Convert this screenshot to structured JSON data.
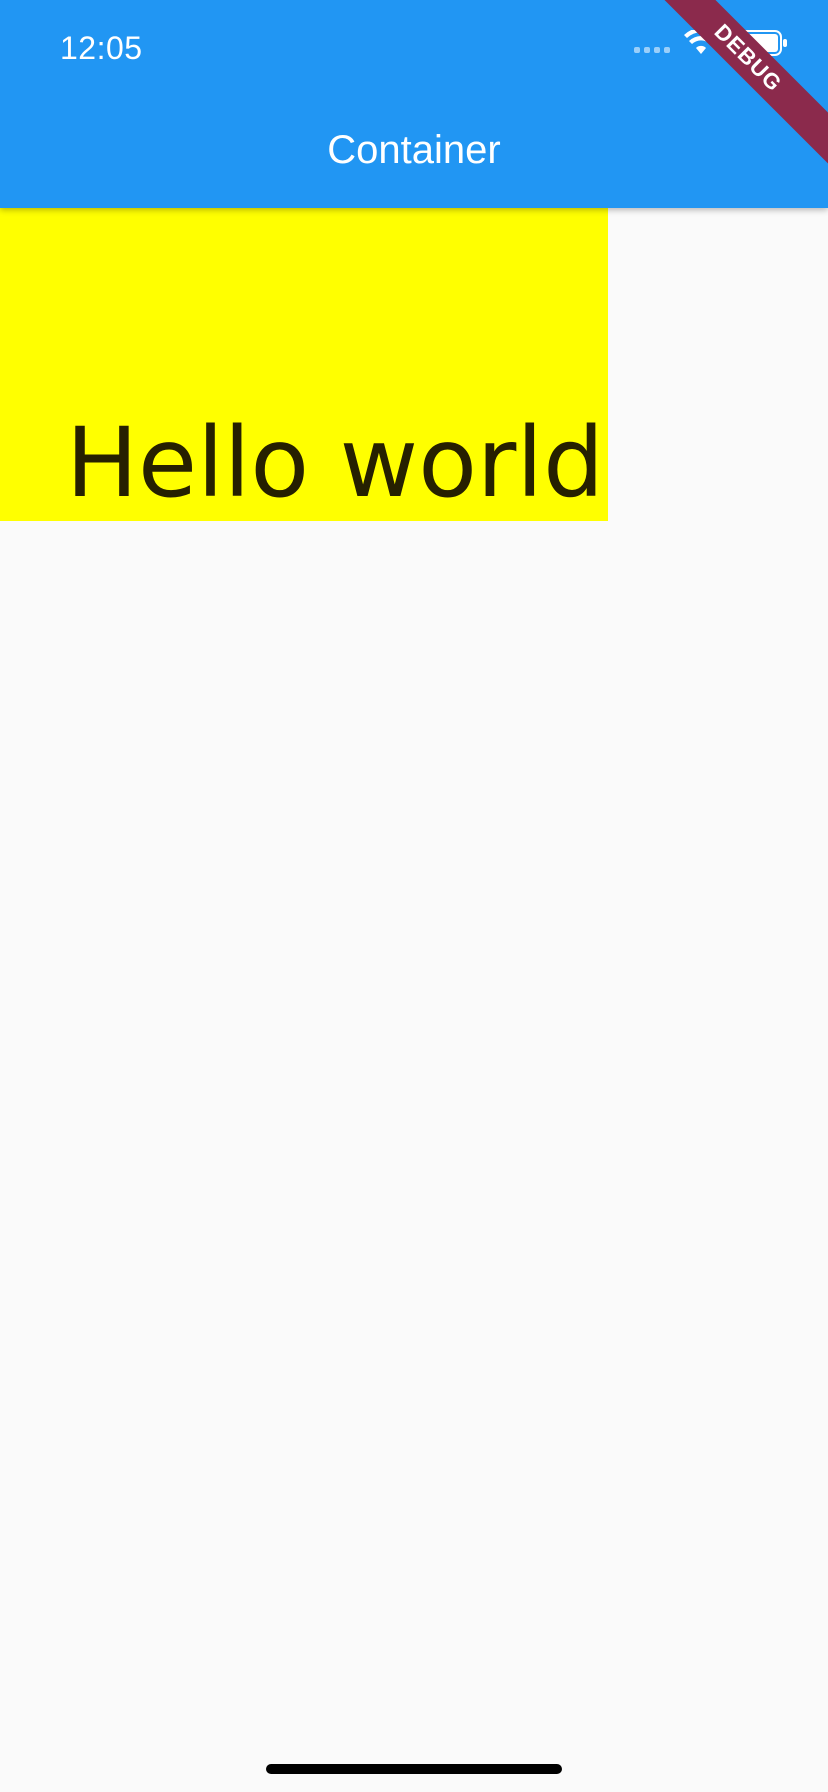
{
  "colors": {
    "app_bar": "#2196F3",
    "container": "#FFFF00",
    "background": "#FAFAFA",
    "ribbon": "#8B2A4C"
  },
  "status_bar": {
    "time": "12:05",
    "icons": [
      "cellular-signal-icon",
      "wifi-icon",
      "battery-icon"
    ]
  },
  "app_bar": {
    "title": "Container"
  },
  "debug_banner": {
    "label": "DEBUG"
  },
  "container": {
    "text": "Hello world"
  }
}
